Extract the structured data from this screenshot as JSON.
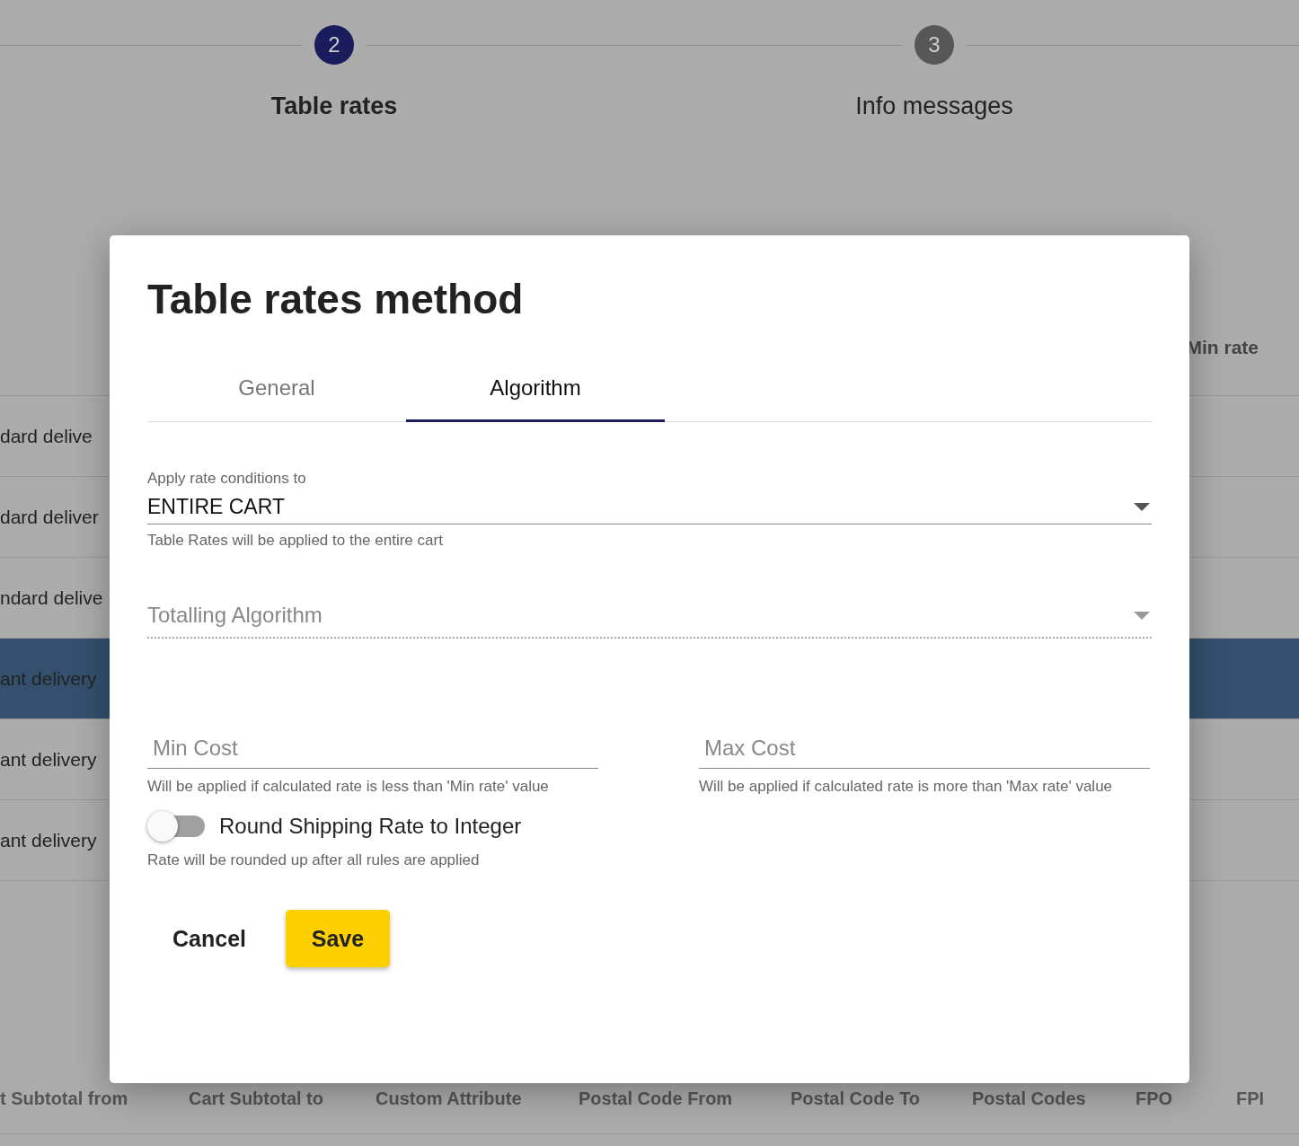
{
  "stepper": {
    "steps": [
      {
        "number": "2",
        "label": "Table rates",
        "selected": true
      },
      {
        "number": "3",
        "label": "Info messages",
        "selected": false
      }
    ]
  },
  "background_table": {
    "header": "Min rate",
    "rows": [
      {
        "name": "dard delive",
        "selected": false
      },
      {
        "name": "dard deliver",
        "selected": false
      },
      {
        "name": "ndard delive",
        "selected": false
      },
      {
        "name": "ant delivery",
        "selected": true
      },
      {
        "name": "ant delivery",
        "selected": false
      },
      {
        "name": "ant delivery",
        "selected": false
      }
    ],
    "columns": [
      "t Subtotal from",
      "Cart Subtotal to",
      "Custom Attribute",
      "Postal Code From",
      "Postal Code To",
      "Postal Codes",
      "FPO",
      "FPI"
    ]
  },
  "dialog": {
    "title": "Table rates method",
    "tabs": [
      {
        "label": "General",
        "selected": false
      },
      {
        "label": "Algorithm",
        "selected": true
      }
    ],
    "fields": [
      {
        "kind": "select",
        "label": "Apply rate conditions to",
        "value": "ENTIRE CART",
        "hint": "Table Rates will be applied to the entire cart",
        "disabled": false
      },
      {
        "kind": "select",
        "placeholder": "Totalling Algorithm",
        "disabled": true
      },
      {
        "kind": "text",
        "placeholder": "Min Cost",
        "hint": "Will be applied if calculated rate is less than 'Min rate' value"
      },
      {
        "kind": "text",
        "placeholder": "Max Cost",
        "hint": "Will be applied if calculated rate is more than 'Max rate' value"
      }
    ],
    "toggle": {
      "label": "Round Shipping Rate to Integer",
      "on": false,
      "hint": "Rate will be rounded up after all rules are applied"
    },
    "buttons": [
      {
        "label": "Cancel",
        "kind": "text"
      },
      {
        "label": "Save",
        "kind": "primary"
      }
    ]
  }
}
